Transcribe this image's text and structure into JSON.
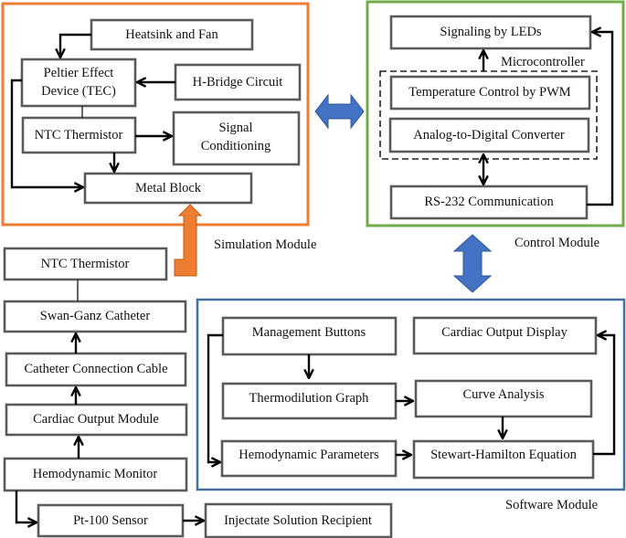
{
  "colors": {
    "simulation": "#ed7d31",
    "control": "#70ad47",
    "software": "#41719c",
    "connector_blue": "#4472c4",
    "connector_orange": "#ed7d31"
  },
  "simulation_module": {
    "label": "Simulation Module",
    "boxes": {
      "heatsink": "Heatsink and Fan",
      "peltier_line1": "Peltier Effect",
      "peltier_line2": "Device (TEC)",
      "hbridge": "H-Bridge Circuit",
      "ntc": "NTC Thermistor",
      "signal_line1": "Signal",
      "signal_line2": "Conditioning",
      "metal_block": "Metal Block"
    }
  },
  "control_module": {
    "label": "Control Module",
    "microcontroller_label": "Microcontroller",
    "boxes": {
      "leds": "Signaling by LEDs",
      "pwm": "Temperature Control by PWM",
      "adc": "Analog-to-Digital Converter",
      "rs232": "RS-232 Communication"
    }
  },
  "hardware_chain": {
    "boxes": {
      "ntc": "NTC Thermistor",
      "swan_ganz": "Swan-Ganz Catheter",
      "cable": "Catheter Connection Cable",
      "co_module": "Cardiac Output Module",
      "monitor": "Hemodynamic Monitor",
      "pt100": "Pt-100 Sensor",
      "injectate": "Injectate Solution Recipient"
    }
  },
  "software_module": {
    "label": "Software Module",
    "boxes": {
      "mgmt": "Management Buttons",
      "co_display": "Cardiac Output Display",
      "thermo_graph": "Thermodilution Graph",
      "curve": "Curve Analysis",
      "hemo_params": "Hemodynamic Parameters",
      "stewart": "Stewart-Hamilton Equation"
    }
  }
}
